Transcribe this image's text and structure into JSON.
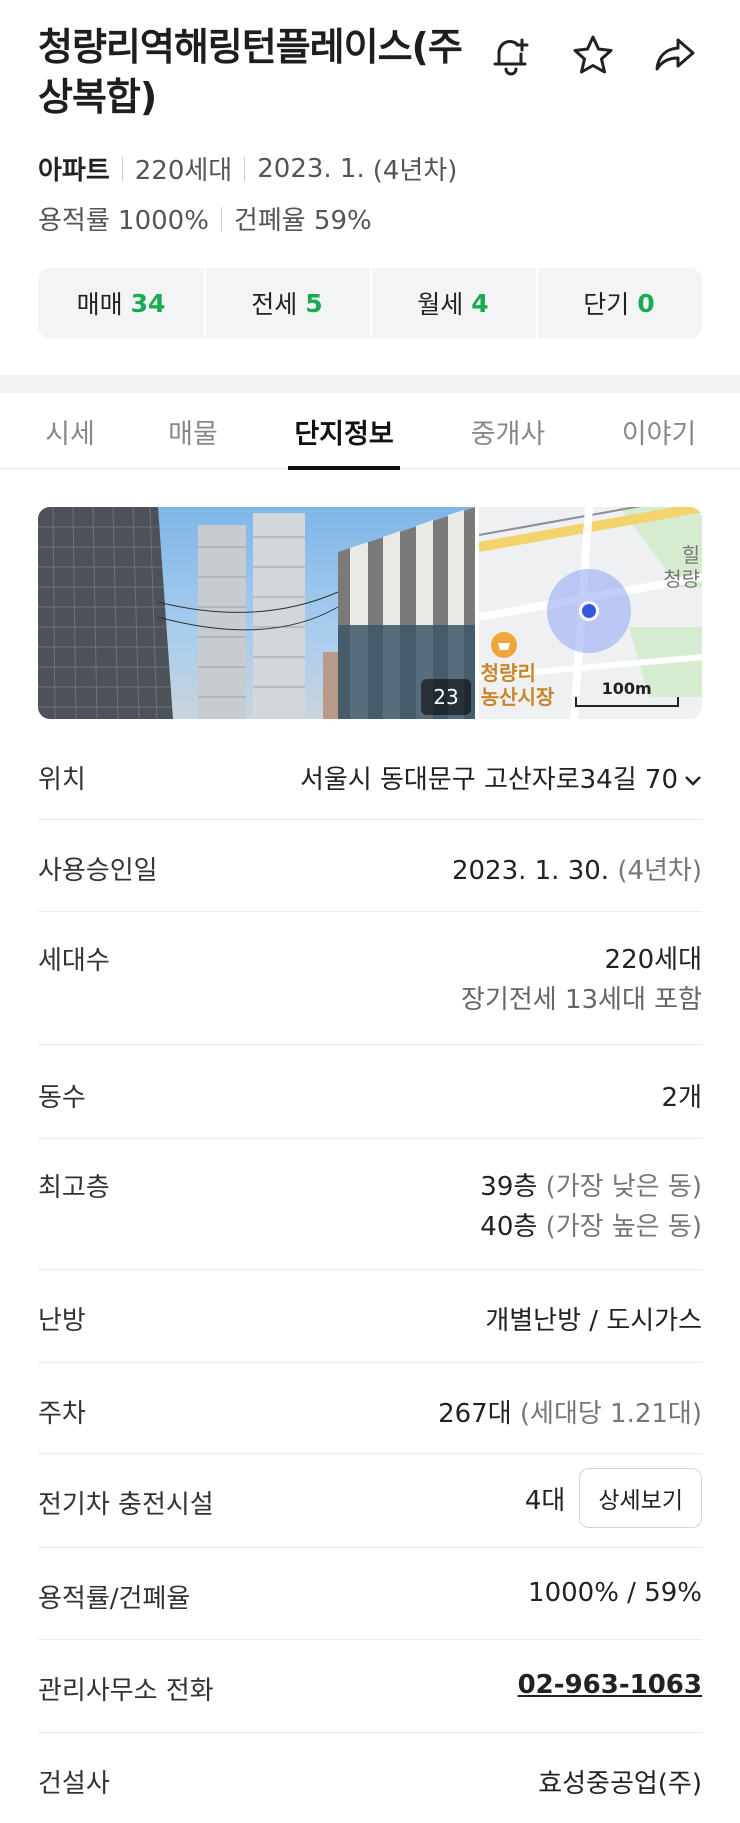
{
  "header": {
    "title": "청량리역해링턴플레이스(주상복합)",
    "icons": [
      "bell-plus-icon",
      "star-icon",
      "share-icon"
    ]
  },
  "meta": {
    "type": "아파트",
    "units": "220세대",
    "completion": "2023. 1.",
    "age": "(4년차)",
    "floor_area_ratio": "용적률 1000%",
    "coverage_ratio": "건폐율 59%"
  },
  "deals": [
    {
      "label": "매매",
      "count": "34"
    },
    {
      "label": "전세",
      "count": "5"
    },
    {
      "label": "월세",
      "count": "4"
    },
    {
      "label": "단기",
      "count": "0"
    }
  ],
  "tabs": [
    {
      "label": "시세",
      "active": false
    },
    {
      "label": "매물",
      "active": false
    },
    {
      "label": "단지정보",
      "active": true
    },
    {
      "label": "중개사",
      "active": false
    },
    {
      "label": "이야기",
      "active": false
    }
  ],
  "media": {
    "photo_count": "23",
    "map_labels": {
      "market_line1": "청량리",
      "market_line2": "농산시장",
      "top_right_1": "힐",
      "top_right_2": "청량",
      "scale": "100m"
    }
  },
  "info": {
    "location": {
      "label": "위치",
      "value": "서울시 동대문구 고산자로34길 70"
    },
    "approval": {
      "label": "사용승인일",
      "value": "2023. 1. 30.",
      "sub": "(4년차)"
    },
    "households": {
      "label": "세대수",
      "value": "220세대",
      "note": "장기전세 13세대 포함"
    },
    "buildings": {
      "label": "동수",
      "value": "2개"
    },
    "top_floor": {
      "label": "최고층",
      "low": "39층",
      "low_note": "(가장 낮은 동)",
      "high": "40층",
      "high_note": "(가장 높은 동)"
    },
    "heating": {
      "label": "난방",
      "value": "개별난방 / 도시가스"
    },
    "parking": {
      "label": "주차",
      "value": "267대",
      "sub": "(세대당 1.21대)"
    },
    "ev": {
      "label": "전기차 충전시설",
      "value": "4대",
      "button": "상세보기"
    },
    "ratio": {
      "label": "용적률/건폐율",
      "value": "1000% / 59%"
    },
    "office_phone": {
      "label": "관리사무소 전화",
      "value": "02-963-1063"
    },
    "builder": {
      "label": "건설사",
      "value": "효성중공업(주)"
    }
  }
}
